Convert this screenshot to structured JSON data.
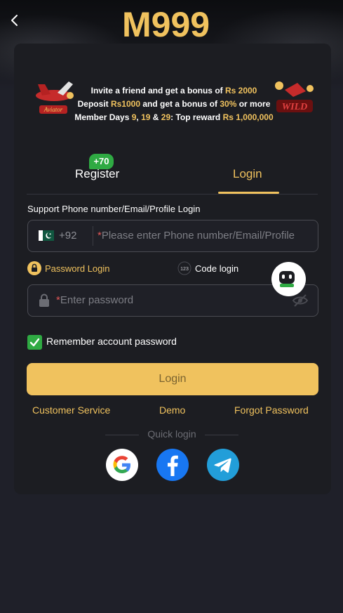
{
  "header": {
    "logo_text": "M999"
  },
  "promo": {
    "line1_prefix": "Invite a friend and get a bonus of ",
    "line1_amount": "Rs 2000",
    "line2_prefix": "Deposit ",
    "line2_amount": "Rs1000",
    "line2_mid": " and get a bonus of ",
    "line2_percent": "30%",
    "line2_suffix": " or more",
    "line3_prefix": "Member Days ",
    "line3_d1": "9",
    "line3_sep1": ", ",
    "line3_d2": "19",
    "line3_sep2": " & ",
    "line3_d3": "29",
    "line3_mid": ": Top reward ",
    "line3_amount": "Rs 1,000,000",
    "left_game_label": "Aviator",
    "right_game_label": "WILD"
  },
  "tabs": {
    "register": "Register",
    "register_badge": "+70",
    "login": "Login"
  },
  "form": {
    "field_title": "Support Phone number/Email/Profile Login",
    "country_code": "+92",
    "required_mark": "*",
    "phone_placeholder": "Please enter Phone number/Email/Profile",
    "mode_password": "Password Login",
    "mode_code": "Code login",
    "password_placeholder": "Enter password",
    "remember_label": "Remember account password",
    "remember_checked": true,
    "login_button": "Login"
  },
  "links": {
    "customer_service": "Customer Service",
    "demo": "Demo",
    "forgot_password": "Forgot Password"
  },
  "quick_login": {
    "title": "Quick login",
    "providers": [
      "google-icon",
      "facebook-icon",
      "telegram-icon"
    ]
  },
  "colors": {
    "accent": "#f0c25e",
    "background": "#1f2029",
    "card": "#1c1d22",
    "success": "#2faa43"
  }
}
